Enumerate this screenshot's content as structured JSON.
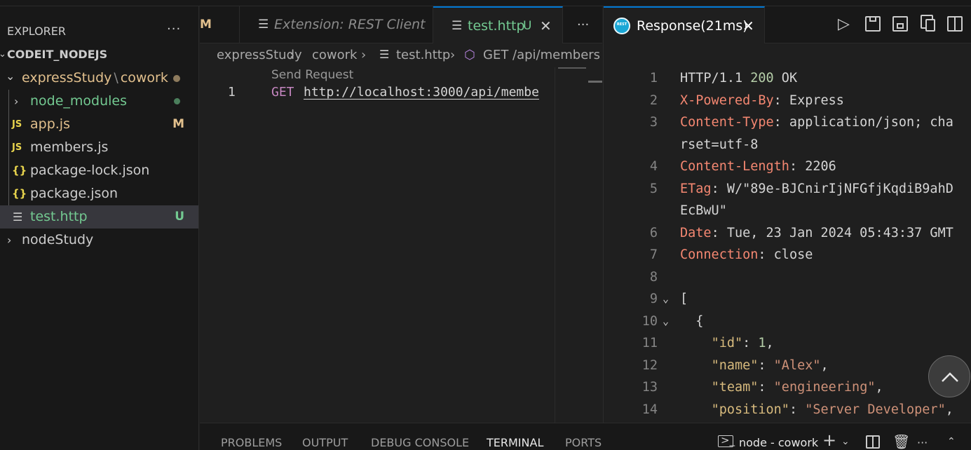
{
  "sidebar": {
    "title": "EXPLORER",
    "more": "···",
    "workspace": "CODEIT_NODEJS",
    "folder_path_1": "expressStudy",
    "folder_sep": "\\",
    "folder_path_2": "cowork",
    "items": [
      {
        "label": "node_modules",
        "icon": "chevron-right-icon",
        "badge": ""
      },
      {
        "label": "app.js",
        "icon": "js-file-icon",
        "icon_text": "JS",
        "badge": "M"
      },
      {
        "label": "members.js",
        "icon": "js-file-icon",
        "icon_text": "JS",
        "badge": ""
      },
      {
        "label": "package-lock.json",
        "icon": "json-file-icon",
        "icon_text": "{}",
        "badge": ""
      },
      {
        "label": "package.json",
        "icon": "json-file-icon",
        "icon_text": "{}",
        "badge": ""
      },
      {
        "label": "test.http",
        "icon": "http-file-icon",
        "badge": "U"
      }
    ],
    "other_folder": "nodeStudy"
  },
  "editor": {
    "tabs": [
      {
        "label": "M"
      },
      {
        "label": "Extension: REST Client"
      },
      {
        "label": "test.http",
        "badge": "U"
      }
    ],
    "more": "···",
    "breadcrumb": [
      "expressStudy",
      "cowork",
      "test.http",
      "GET /api/members"
    ],
    "codelens": "Send Request",
    "line_number": "1",
    "method": "GET",
    "url": "http://localhost:3000/api/membe"
  },
  "response": {
    "tab_label": "Response(21ms)",
    "icon_text": "REST",
    "lines": [
      {
        "n": "1",
        "parts": [
          [
            "k-plain",
            "HTTP/1.1 "
          ],
          [
            "k-num",
            "200"
          ],
          [
            "k-plain",
            " OK"
          ]
        ]
      },
      {
        "n": "2",
        "parts": [
          [
            "k-hdr",
            "X-Powered-By"
          ],
          [
            "k-plain",
            ": Express"
          ]
        ]
      },
      {
        "n": "3",
        "parts": [
          [
            "k-hdr",
            "Content-Type"
          ],
          [
            "k-plain",
            ": application/json; cha"
          ]
        ]
      },
      {
        "n": "",
        "parts": [
          [
            "k-plain",
            "rset=utf-8"
          ]
        ]
      },
      {
        "n": "4",
        "parts": [
          [
            "k-hdr",
            "Content-Length"
          ],
          [
            "k-plain",
            ": 2206"
          ]
        ]
      },
      {
        "n": "5",
        "parts": [
          [
            "k-hdr",
            "ETag"
          ],
          [
            "k-plain",
            ": W/\"89e-BJCnirIjNFGfjKqdiB9ahD"
          ]
        ]
      },
      {
        "n": "",
        "parts": [
          [
            "k-plain",
            "EcBwU\""
          ]
        ]
      },
      {
        "n": "6",
        "parts": [
          [
            "k-hdr",
            "Date"
          ],
          [
            "k-plain",
            ": Tue, 23 Jan 2024 05:43:37 GMT"
          ]
        ]
      },
      {
        "n": "7",
        "parts": [
          [
            "k-hdr",
            "Connection"
          ],
          [
            "k-plain",
            ": close"
          ]
        ]
      },
      {
        "n": "8",
        "parts": []
      },
      {
        "n": "9",
        "fold": true,
        "parts": [
          [
            "k-plain",
            "["
          ]
        ]
      },
      {
        "n": "10",
        "fold": true,
        "parts": [
          [
            "k-plain",
            "  {"
          ]
        ]
      },
      {
        "n": "11",
        "parts": [
          [
            "k-plain",
            "    "
          ],
          [
            "k-json",
            "\"id\""
          ],
          [
            "k-plain",
            ": "
          ],
          [
            "k-num",
            "1"
          ],
          [
            "k-plain",
            ","
          ]
        ]
      },
      {
        "n": "12",
        "parts": [
          [
            "k-plain",
            "    "
          ],
          [
            "k-json",
            "\"name\""
          ],
          [
            "k-plain",
            ": "
          ],
          [
            "k-str",
            "\"Alex\""
          ],
          [
            "k-plain",
            ","
          ]
        ]
      },
      {
        "n": "13",
        "parts": [
          [
            "k-plain",
            "    "
          ],
          [
            "k-json",
            "\"team\""
          ],
          [
            "k-plain",
            ": "
          ],
          [
            "k-str",
            "\"engineering\""
          ],
          [
            "k-plain",
            ","
          ]
        ]
      },
      {
        "n": "14",
        "parts": [
          [
            "k-plain",
            "    "
          ],
          [
            "k-json",
            "\"position\""
          ],
          [
            "k-plain",
            ": "
          ],
          [
            "k-str",
            "\"Server Developer\""
          ],
          [
            "k-plain",
            ","
          ]
        ]
      }
    ]
  },
  "panel": {
    "tabs": [
      "PROBLEMS",
      "OUTPUT",
      "DEBUG CONSOLE",
      "TERMINAL",
      "PORTS"
    ],
    "active_tab": "TERMINAL",
    "terminal_label": "node - cowork"
  },
  "colors": {
    "modified": "#e2c08d",
    "untracked": "#73c991",
    "accent": "#0078d4"
  }
}
